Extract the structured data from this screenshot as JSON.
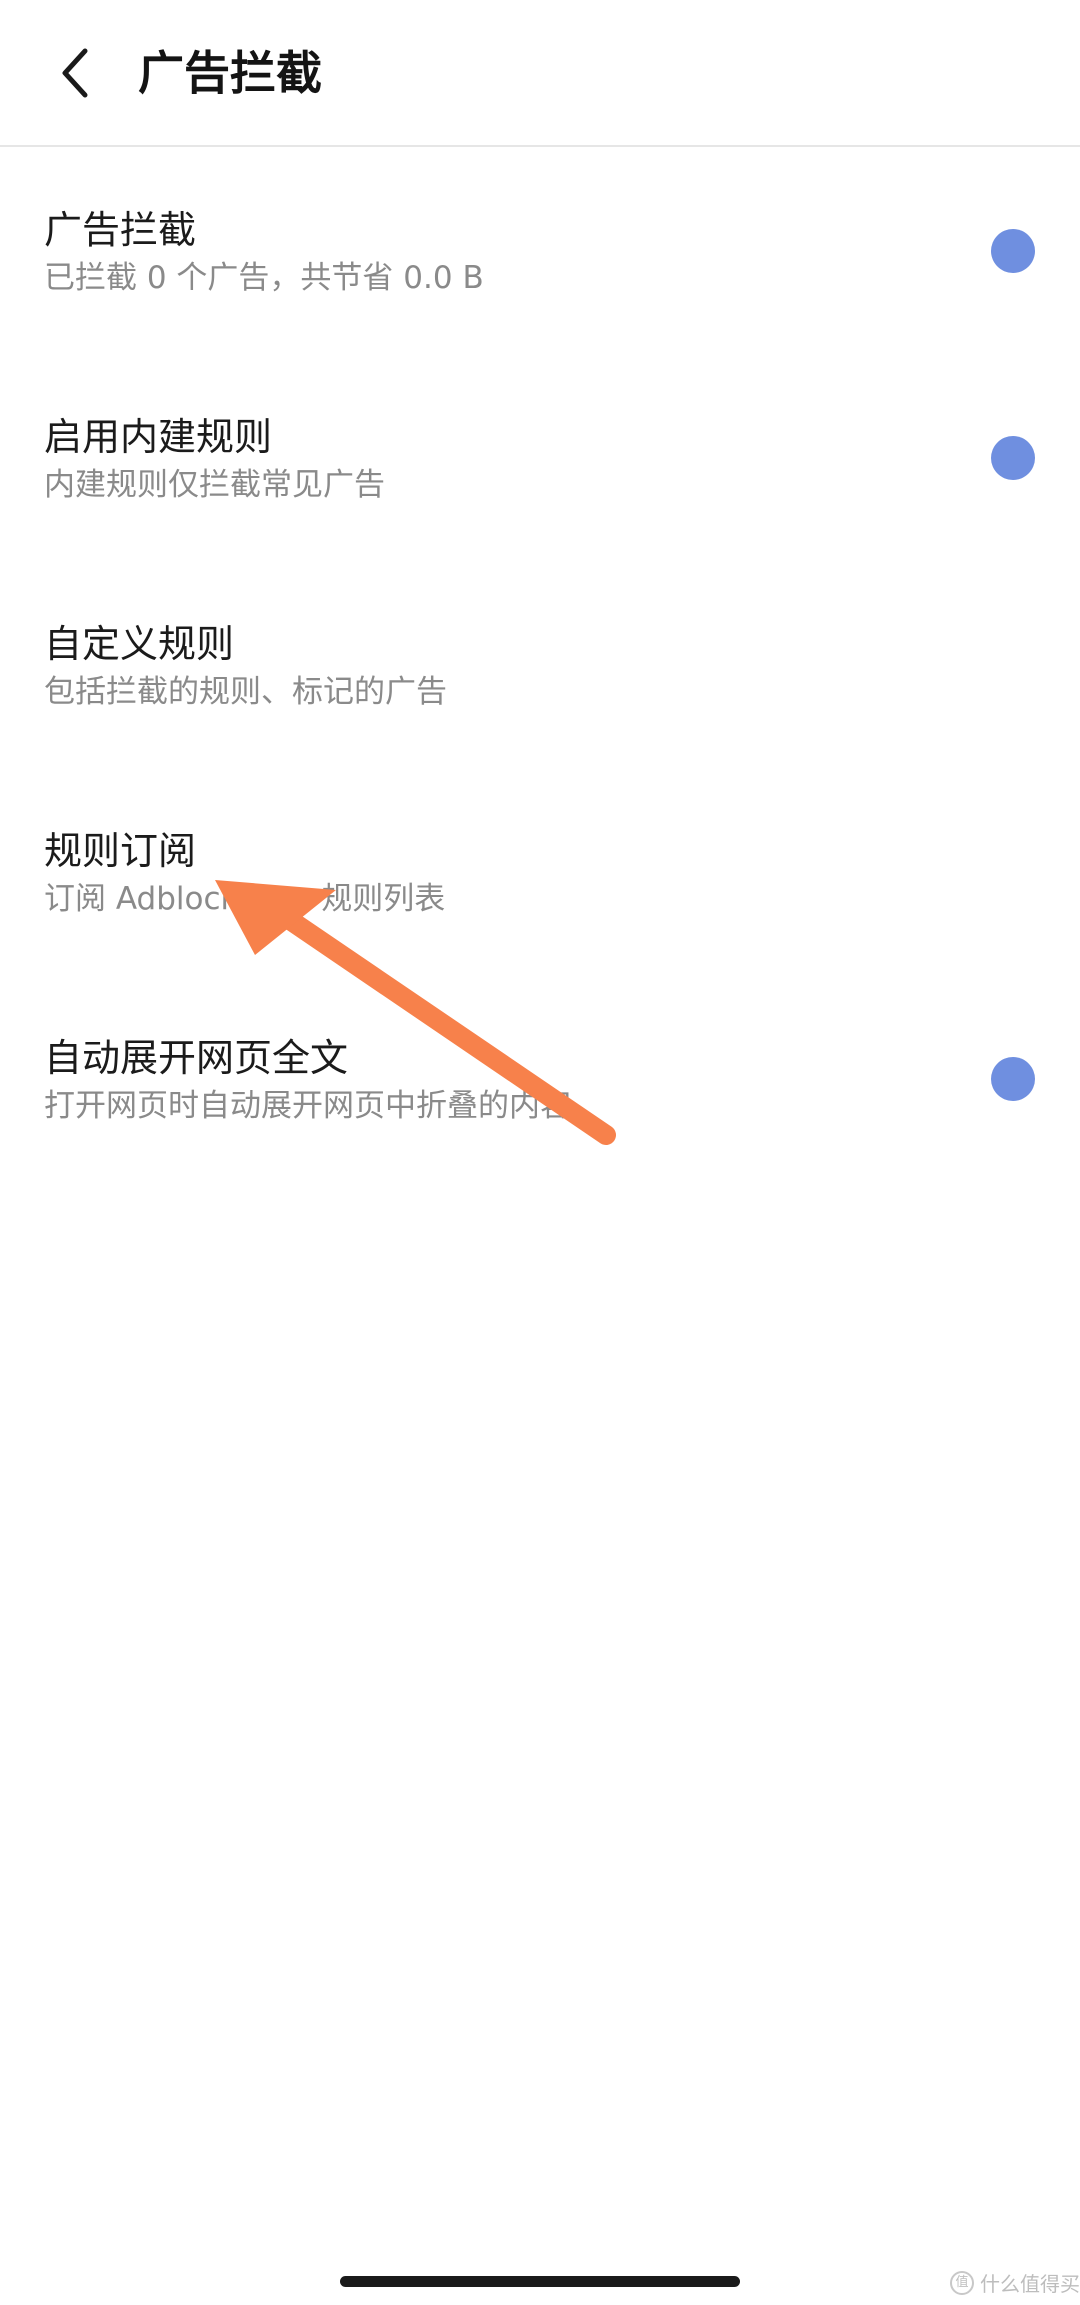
{
  "header": {
    "title": "广告拦截",
    "back_icon": "chevron-left-icon"
  },
  "settings": [
    {
      "title": "广告拦截",
      "description": "已拦截 0 个广告，共节省 0.0 B",
      "has_toggle": true,
      "toggle_on": true
    },
    {
      "title": "启用内建规则",
      "description": "内建规则仅拦截常见广告",
      "has_toggle": true,
      "toggle_on": true
    },
    {
      "title": "自定义规则",
      "description": "包括拦截的规则、标记的广告",
      "has_toggle": false
    },
    {
      "title": "规则订阅",
      "description": "订阅 Adblock Plus 规则列表",
      "has_toggle": false
    },
    {
      "title": "自动展开网页全文",
      "description": "打开网页时自动展开网页中折叠的内容",
      "has_toggle": true,
      "toggle_on": true
    }
  ],
  "watermark": {
    "logo_glyph": "值",
    "text": "什么值得买"
  },
  "colors": {
    "toggle": "#6f8fe0",
    "annotation_arrow": "#f7814b",
    "title_text": "#1b1b1b",
    "description_text": "#8a8a8a",
    "divider": "#e6e6e6"
  }
}
